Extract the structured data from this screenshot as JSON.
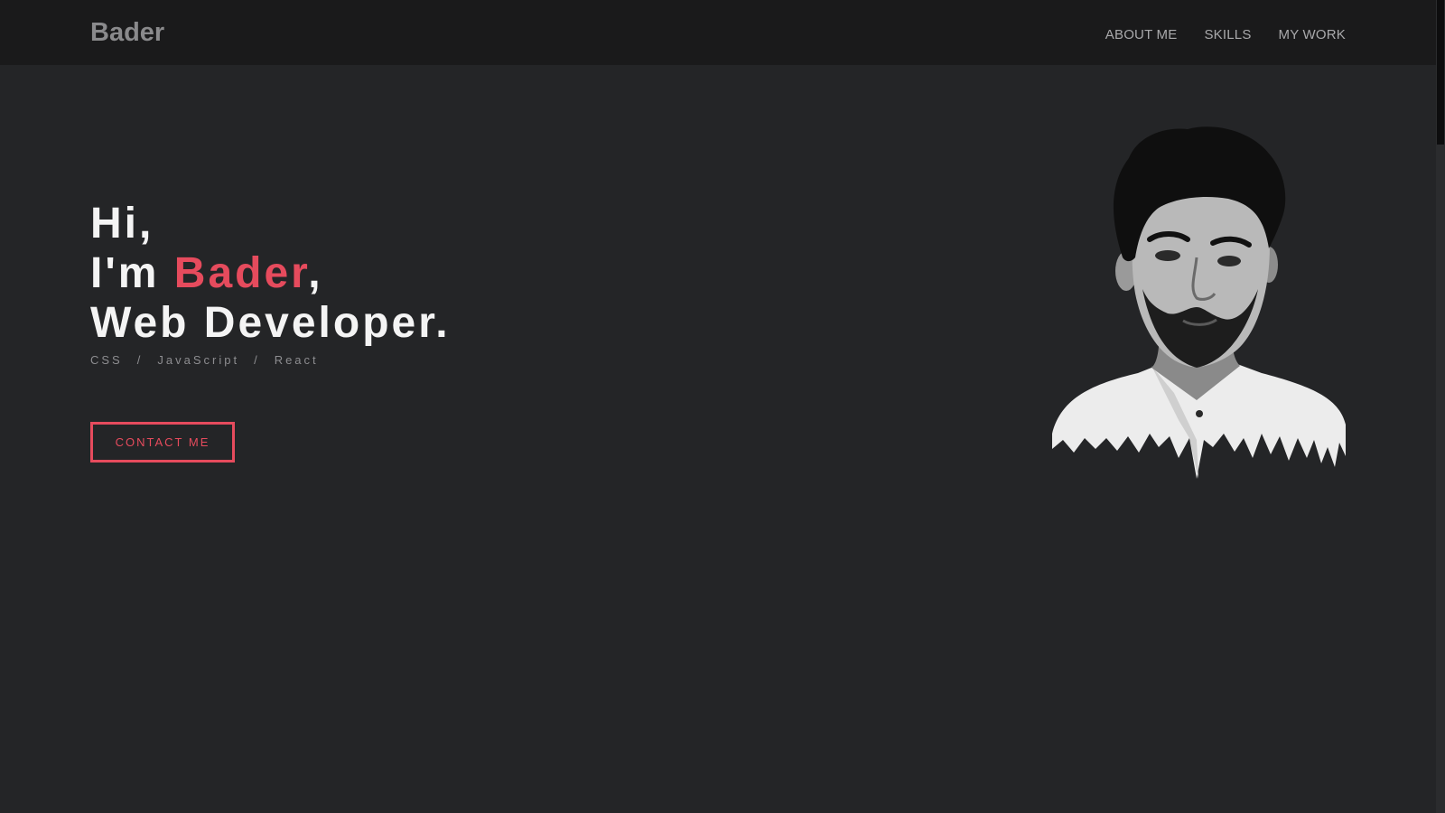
{
  "brand": {
    "name": "Bader"
  },
  "nav": {
    "items": [
      {
        "label": "ABOUT ME"
      },
      {
        "label": "SKILLS"
      },
      {
        "label": "MY WORK"
      }
    ]
  },
  "hero": {
    "greeting": "Hi,",
    "intro_prefix": "I'm",
    "name": "Bader",
    "intro_suffix": ",",
    "role": "Web Developer.",
    "skills": [
      "CSS",
      "/",
      "JavaScript",
      "/",
      "React"
    ],
    "cta_label": "CONTACT ME"
  },
  "colors": {
    "accent": "#e64b5d",
    "background": "#242527",
    "navbar": "#1a1a1b",
    "text": "#f4f4f4",
    "muted": "#8d8d90"
  },
  "portrait": {
    "icon": "portrait-photo"
  }
}
